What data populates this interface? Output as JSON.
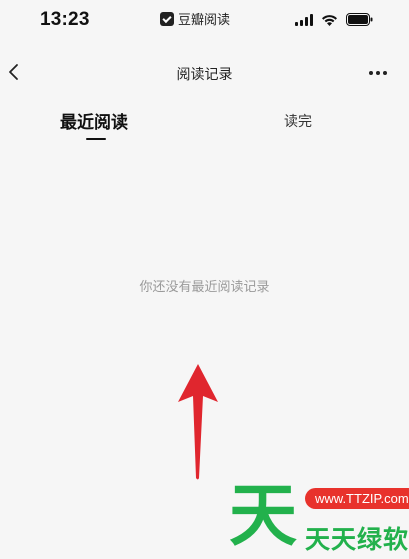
{
  "status_bar": {
    "time": "13:23",
    "app_name": "豆瓣阅读"
  },
  "nav": {
    "title": "阅读记录",
    "back_icon": "chevron-left-icon",
    "more_icon": "ellipsis-icon"
  },
  "tabs": [
    {
      "label": "最近阅读",
      "active": true
    },
    {
      "label": "读完",
      "active": false
    }
  ],
  "empty_state": {
    "message": "你还没有最近阅读记录"
  },
  "annotation": {
    "arrow_color": "#e0262e"
  },
  "watermark": {
    "big_char": "天",
    "site": "www.TTZIP.com",
    "name": "天天绿软",
    "green": "#22b14c",
    "red": "#e8322c"
  }
}
